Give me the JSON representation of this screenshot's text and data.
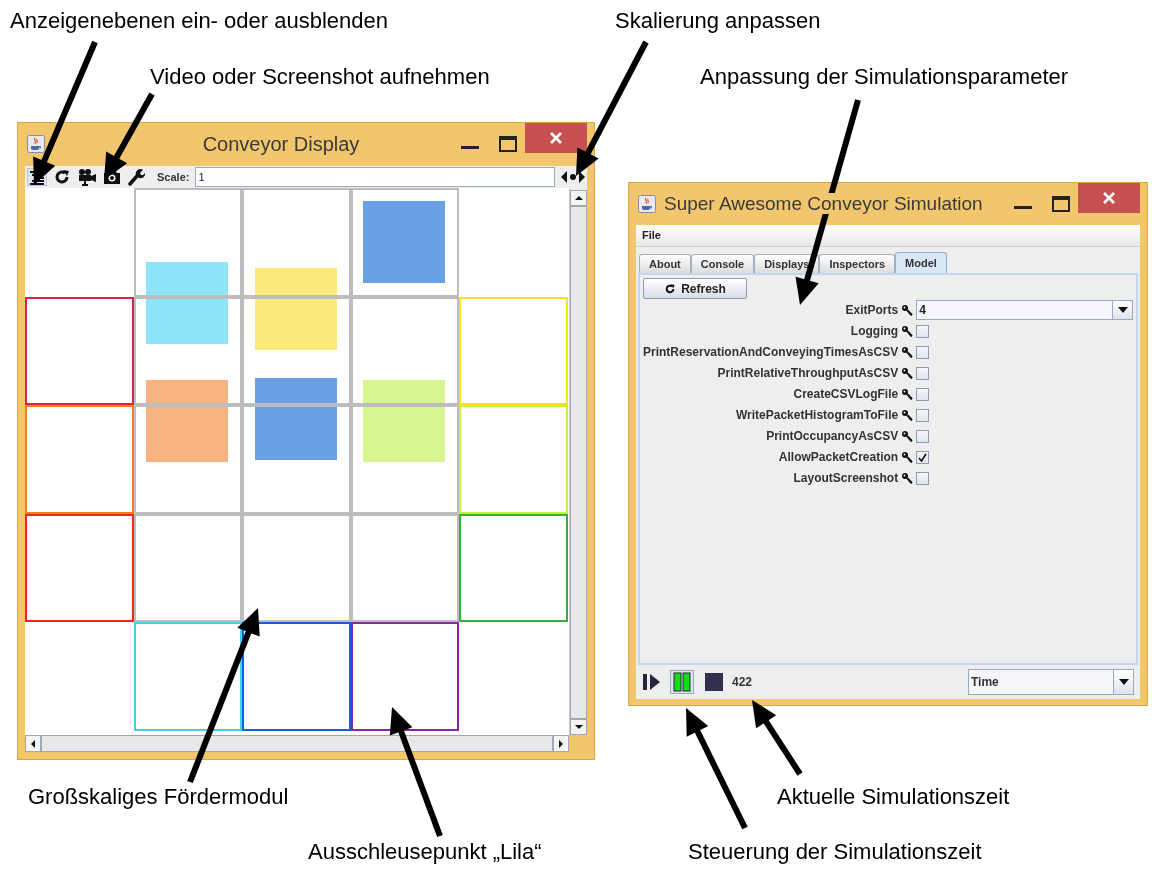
{
  "annotations": [
    {
      "text": "Anzeigenebenen ein- oder ausblenden"
    },
    {
      "text": "Video oder Screenshot aufnehmen"
    },
    {
      "text": "Skalierung anpassen"
    },
    {
      "text": "Anpassung der Simulationsparameter"
    },
    {
      "text": "Großskaliges Fördermodul"
    },
    {
      "text": "Ausschleusepunkt „Lila“"
    },
    {
      "text": "Aktuelle Simulationszeit"
    },
    {
      "text": "Steuerung der Simulationszeit"
    }
  ],
  "conveyor_window": {
    "title": "Conveyor Display",
    "scale_label": "Scale:",
    "scale_value": "1",
    "exit_ports": [
      {
        "color": "#e0204a"
      },
      {
        "color": "#f08020"
      },
      {
        "color": "#ff2020"
      },
      {
        "color": "#ffe020"
      },
      {
        "color": "#c8f040"
      },
      {
        "color": "#30b040"
      },
      {
        "color": "#40d0f0"
      },
      {
        "color": "#1060e0"
      },
      {
        "color": "#9020b0"
      }
    ],
    "packets": [
      {
        "color": "#8fe5f8"
      },
      {
        "color": "#fde97a"
      },
      {
        "color": "#6aa1e4"
      },
      {
        "color": "#f7b283"
      },
      {
        "color": "#6aa1e4"
      },
      {
        "color": "#d9f591"
      }
    ]
  },
  "simulation_window": {
    "title": "Super Awesome Conveyor Simulation",
    "menu": [
      "File"
    ],
    "tabs": [
      {
        "label": "About",
        "selected": false
      },
      {
        "label": "Console",
        "selected": false
      },
      {
        "label": "Displays",
        "selected": false
      },
      {
        "label": "Inspectors",
        "selected": false
      },
      {
        "label": "Model",
        "selected": true
      }
    ],
    "refresh_button": "Refresh",
    "parameters": [
      {
        "label": "ExitPorts",
        "kind": "dropdown",
        "value": "4"
      },
      {
        "label": "Logging",
        "kind": "checkbox",
        "checked": false
      },
      {
        "label": "PrintReservationAndConveyingTimesAsCSV",
        "kind": "checkbox",
        "checked": false
      },
      {
        "label": "PrintRelativeThroughputAsCSV",
        "kind": "checkbox",
        "checked": false
      },
      {
        "label": "CreateCSVLogFile",
        "kind": "checkbox",
        "checked": false
      },
      {
        "label": "WritePacketHistogramToFile",
        "kind": "checkbox",
        "checked": false
      },
      {
        "label": "PrintOccupancyAsCSV",
        "kind": "checkbox",
        "checked": false
      },
      {
        "label": "AllowPacketCreation",
        "kind": "checkbox",
        "checked": true
      },
      {
        "label": "LayoutScreenshot",
        "kind": "checkbox",
        "checked": false
      }
    ],
    "time": "422",
    "time_mode": "Time"
  }
}
